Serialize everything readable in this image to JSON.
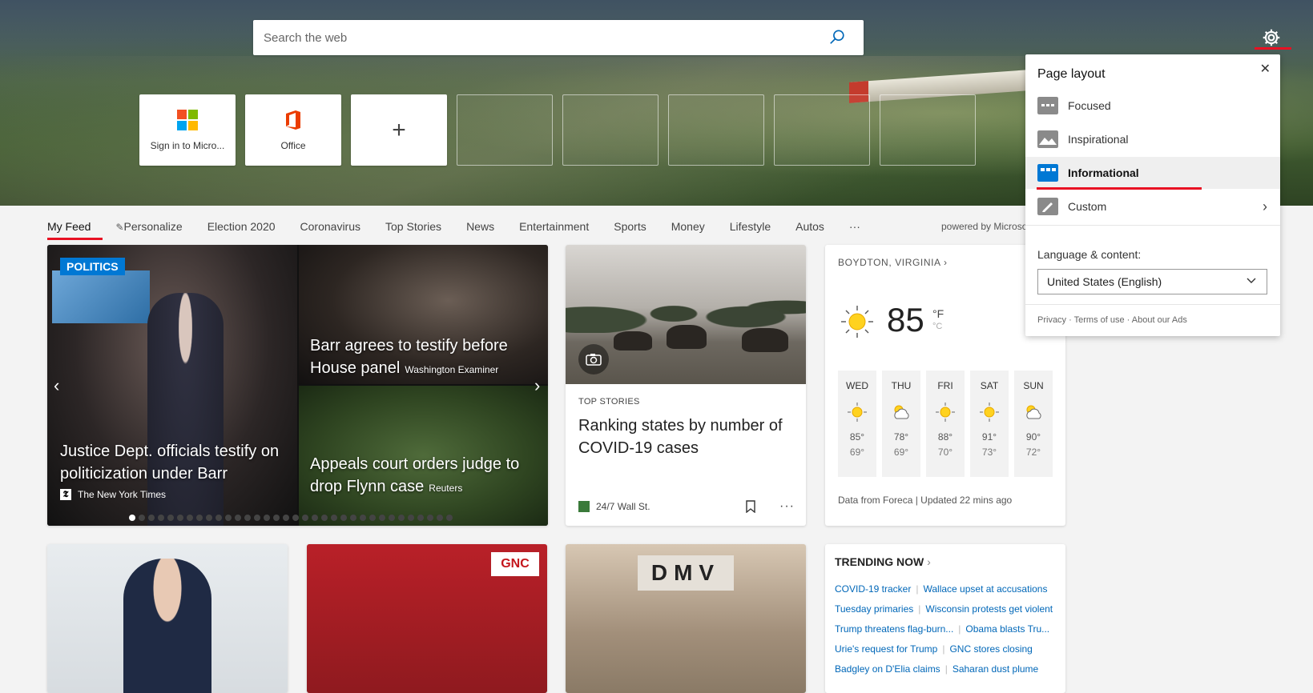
{
  "search": {
    "placeholder": "Search the web"
  },
  "tiles": [
    {
      "label": "Sign in to Micro..."
    },
    {
      "label": "Office"
    },
    {
      "label": "+"
    }
  ],
  "nav": {
    "items": [
      "My Feed",
      "Personalize",
      "Election 2020",
      "Coronavirus",
      "Top Stories",
      "News",
      "Entertainment",
      "Sports",
      "Money",
      "Lifestyle",
      "Autos",
      "···"
    ],
    "powered": "powered by Microso"
  },
  "hero": {
    "badge": "POLITICS",
    "story1_title": "Justice Dept. officials testify on politicization under Barr",
    "story1_source": "The New York Times",
    "story2_title": "Barr agrees to testify before House panel",
    "story2_source": "Washington Examiner",
    "story3_title": "Appeals court orders judge to drop Flynn case",
    "story3_source": "Reuters",
    "dot_count": 34,
    "active_dot": 0
  },
  "story": {
    "kicker": "TOP STORIES",
    "title": "Ranking states by number of COVID-19 cases",
    "source": "24/7 Wall St."
  },
  "weather": {
    "location": "BOYDTON, VIRGINIA",
    "temp": "85",
    "unit_f": "°F",
    "unit_c": "°C",
    "days": [
      {
        "name": "WED",
        "hi": "85°",
        "lo": "69°",
        "icon": "sun-icon"
      },
      {
        "name": "THU",
        "hi": "78°",
        "lo": "69°",
        "icon": "partly-cloudy-icon"
      },
      {
        "name": "FRI",
        "hi": "88°",
        "lo": "70°",
        "icon": "sun-icon"
      },
      {
        "name": "SAT",
        "hi": "91°",
        "lo": "73°",
        "icon": "sun-icon"
      },
      {
        "name": "SUN",
        "hi": "90°",
        "lo": "72°",
        "icon": "partly-cloudy-icon"
      }
    ],
    "footer": "Data from Foreca | Updated 22 mins ago"
  },
  "trending": {
    "title": "TRENDING NOW",
    "rows": [
      [
        "COVID-19 tracker",
        "Wallace upset at accusations"
      ],
      [
        "Tuesday primaries",
        "Wisconsin protests get violent"
      ],
      [
        "Trump threatens flag-burn...",
        "Obama blasts Tru..."
      ],
      [
        "Urie's request for Trump",
        "GNC stores closing"
      ],
      [
        "Badgley on D'Elia claims",
        "Saharan dust plume"
      ]
    ]
  },
  "panel": {
    "title": "Page layout",
    "options": [
      "Focused",
      "Inspirational",
      "Informational",
      "Custom"
    ],
    "selected": "Informational",
    "lang_label": "Language & content:",
    "lang_value": "United States (English)",
    "links": "Privacy · Terms of use · About our Ads"
  },
  "colors": {
    "accent": "#e81123",
    "link": "#0067b8",
    "badge": "#0078d4"
  }
}
